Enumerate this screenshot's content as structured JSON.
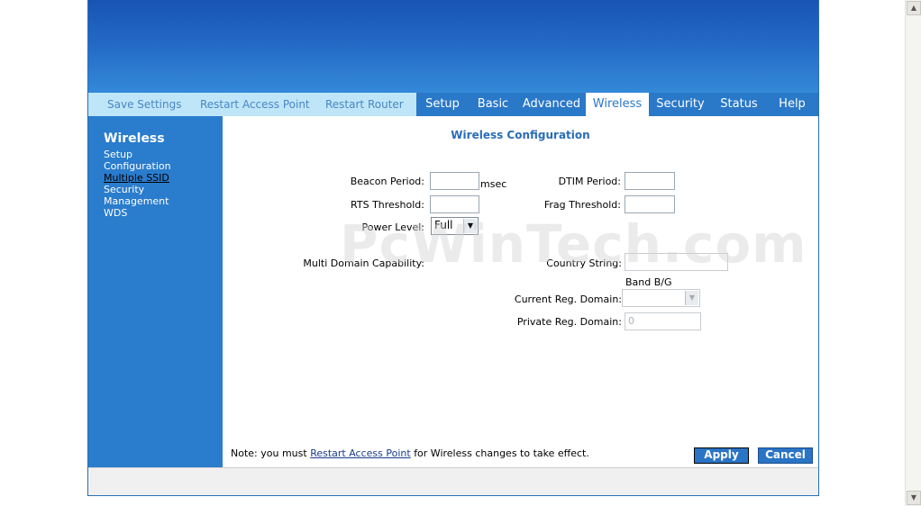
{
  "nav": {
    "save_settings": "Save Settings",
    "restart_access_point": "Restart Access Point",
    "restart_router": "Restart Router"
  },
  "tabs": [
    {
      "label": "Setup"
    },
    {
      "label": "Basic"
    },
    {
      "label": "Advanced"
    },
    {
      "label": "Wireless"
    },
    {
      "label": "Security"
    },
    {
      "label": "Status"
    },
    {
      "label": "Help"
    }
  ],
  "sidebar": {
    "title": "Wireless",
    "items": [
      {
        "label": "Setup"
      },
      {
        "label": "Configuration"
      },
      {
        "label": "Multiple SSID"
      },
      {
        "label": "Security"
      },
      {
        "label": "Management"
      },
      {
        "label": "WDS"
      }
    ]
  },
  "main": {
    "title": "Wireless Configuration",
    "beacon_period_label": "Beacon Period:",
    "beacon_period_unit": "msec",
    "dtim_period_label": "DTIM Period:",
    "rts_threshold_label": "RTS Threshold:",
    "frag_threshold_label": "Frag Threshold:",
    "power_level_label": "Power Level:",
    "power_level_value": "Full",
    "multi_domain_label": "Multi Domain Capability:",
    "country_string_label": "Country String:",
    "band_label": "Band B/G",
    "current_reg_domain_label": "Current Reg. Domain:",
    "private_reg_domain_label": "Private Reg. Domain:",
    "private_reg_domain_value": "0"
  },
  "watermark": "PcWinTech.com",
  "footer": {
    "note_prefix": "Note: you must",
    "note_link": "Restart Access Point",
    "note_suffix": "for Wireless changes to take effect.",
    "apply": "Apply",
    "cancel": "Cancel"
  },
  "colors": {
    "banner": "#2368c4",
    "tab_bar": "#2a78c8",
    "nav_light": "#bfe6f8",
    "sidebar": "#2a7ccc",
    "title": "#2a6cb8"
  }
}
